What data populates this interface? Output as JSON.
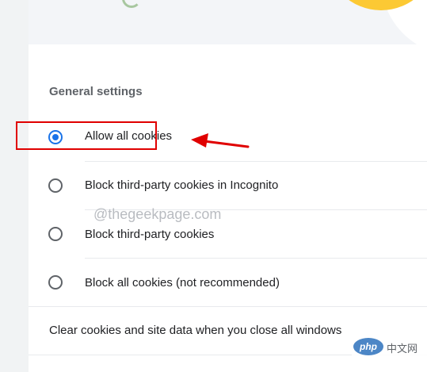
{
  "general_settings": {
    "title": "General settings",
    "options": [
      {
        "label": "Allow all cookies",
        "selected": true
      },
      {
        "label": "Block third-party cookies in Incognito",
        "selected": false
      },
      {
        "label": "Block third-party cookies",
        "selected": false
      },
      {
        "label": "Block all cookies (not recommended)",
        "selected": false
      }
    ]
  },
  "clear_on_exit": {
    "label": "Clear cookies and site data when you close all windows"
  },
  "watermark": {
    "text": "@thegeekpage.com"
  },
  "site_logo": {
    "brand": "php",
    "text": "中文网"
  },
  "annotation": {
    "color": "#e00000"
  },
  "colors": {
    "accent": "#1a73e8",
    "hero_yellow": "#fcc934"
  }
}
